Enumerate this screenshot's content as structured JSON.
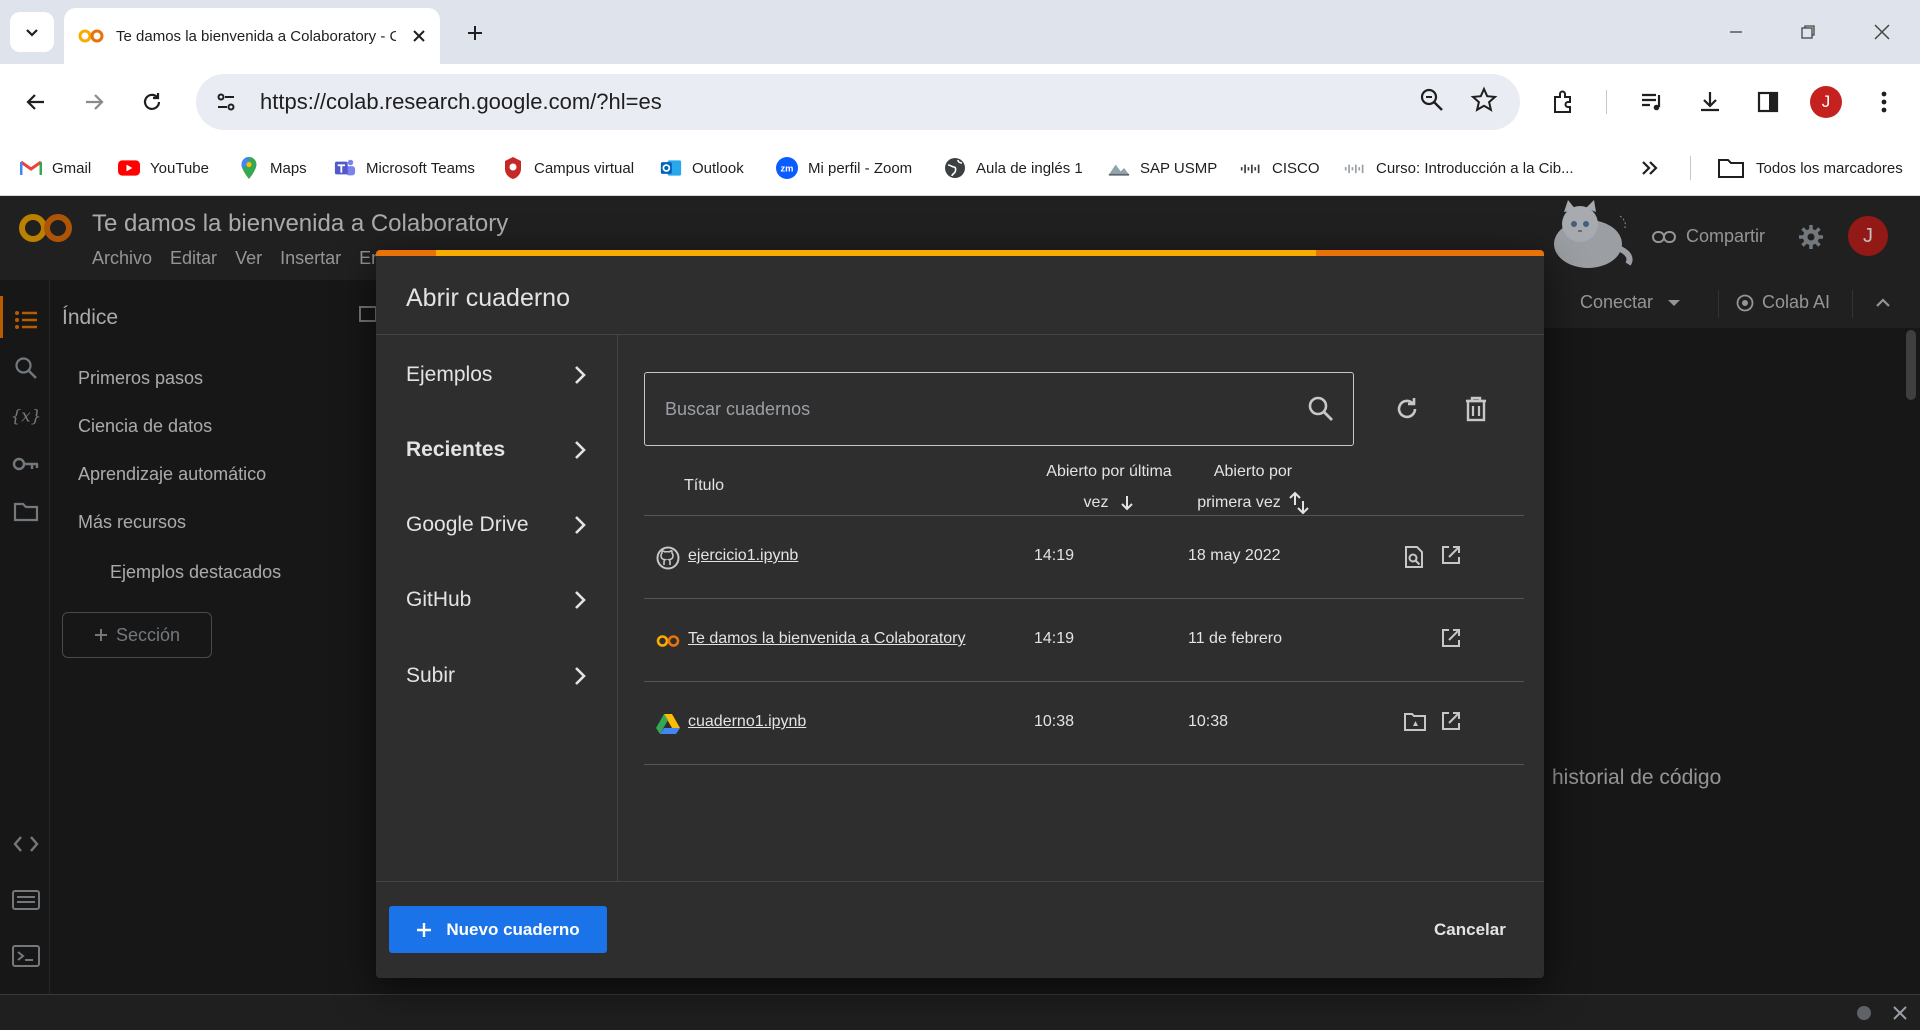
{
  "browser": {
    "tab_title": "Te damos la bienvenida a Colaboratory - C",
    "url": "https://colab.research.google.com/?hl=es",
    "profile_initial": "J",
    "bookmarks": [
      {
        "label": "Gmail",
        "icon": "gmail-icon"
      },
      {
        "label": "YouTube",
        "icon": "youtube-icon"
      },
      {
        "label": "Maps",
        "icon": "maps-icon"
      },
      {
        "label": "Microsoft Teams",
        "icon": "teams-icon"
      },
      {
        "label": "Campus virtual",
        "icon": "campus-icon"
      },
      {
        "label": "Outlook",
        "icon": "outlook-icon"
      },
      {
        "label": "Mi perfil - Zoom",
        "icon": "zoom-icon"
      },
      {
        "label": "Aula de inglés 1",
        "icon": "globe-icon"
      },
      {
        "label": "SAP USMP",
        "icon": "sap-icon"
      },
      {
        "label": "CISCO",
        "icon": "cisco-icon"
      },
      {
        "label": "Curso: Introducción a la Cib...",
        "icon": "cisco-icon"
      }
    ],
    "all_bookmarks_label": "Todos los marcadores"
  },
  "colab": {
    "doc_title": "Te damos la bienvenida a Colaboratory",
    "menu": [
      "Archivo",
      "Editar",
      "Ver",
      "Insertar",
      "En"
    ],
    "share_label": "Compartir",
    "avatar_initial": "J",
    "connect_label": "Conectar",
    "colab_ai_label": "Colab AI",
    "toc": {
      "title": "Índice",
      "items": [
        "Primeros pasos",
        "Ciencia de datos",
        "Aprendizaje automático",
        "Más recursos",
        "Ejemplos destacados"
      ],
      "section_label": "Sección"
    },
    "background_text": "historial de código"
  },
  "dialog": {
    "title": "Abrir cuaderno",
    "sidebar": [
      "Ejemplos",
      "Recientes",
      "Google Drive",
      "GitHub",
      "Subir"
    ],
    "active_sidebar": "Recientes",
    "search_placeholder": "Buscar cuadernos",
    "columns": {
      "title": "Título",
      "last_opened_line1": "Abierto por última",
      "last_opened_line2": "vez",
      "first_opened_line1": "Abierto por",
      "first_opened_line2": "primera vez"
    },
    "rows": [
      {
        "title": "ejercicio1.ipynb",
        "last_opened": "14:19",
        "first_opened": "18 may 2022",
        "source_icon": "github-icon"
      },
      {
        "title": "Te damos la bienvenida a Colaboratory",
        "last_opened": "14:19",
        "first_opened": "11 de febrero",
        "source_icon": "colab-icon"
      },
      {
        "title": "cuaderno1.ipynb",
        "last_opened": "10:38",
        "first_opened": "10:38",
        "source_icon": "drive-icon"
      }
    ],
    "new_notebook_label": "Nuevo cuaderno",
    "cancel_label": "Cancelar"
  },
  "colors": {
    "accent_blue": "#1a73e8",
    "colab_orange": "#f9ab00",
    "dark_bg": "#1f1f1f",
    "dialog_bg": "#2e2e2e"
  }
}
